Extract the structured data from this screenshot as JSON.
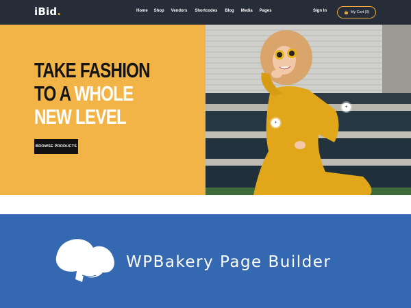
{
  "header": {
    "logo_text": "iBid",
    "logo_dot": ".",
    "menu": [
      {
        "label": "Home"
      },
      {
        "label": "Shop"
      },
      {
        "label": "Vendors"
      },
      {
        "label": "Shortcodes"
      },
      {
        "label": "Blog"
      },
      {
        "label": "Media"
      },
      {
        "label": "Pages"
      }
    ],
    "signin_label": "Sign In",
    "cart_label": "My Cart (0)",
    "cart_icon": "basket-icon"
  },
  "hero": {
    "line1": "TAKE FASHION",
    "line2_plain": "TO A ",
    "line2_accent": "WHOLE",
    "line3": "NEW LEVEL",
    "cta_label": "BROWSE PRODUCTS",
    "hotspot_label": "+"
  },
  "banner": {
    "brand_text": "WPBakery Page Builder",
    "logo_icon": "chef-hat-icon"
  },
  "colors": {
    "nav_bg": "#262c38",
    "accent": "#f0ab3a",
    "hero_bg": "#f2b446",
    "banner_bg": "#3469b1"
  }
}
